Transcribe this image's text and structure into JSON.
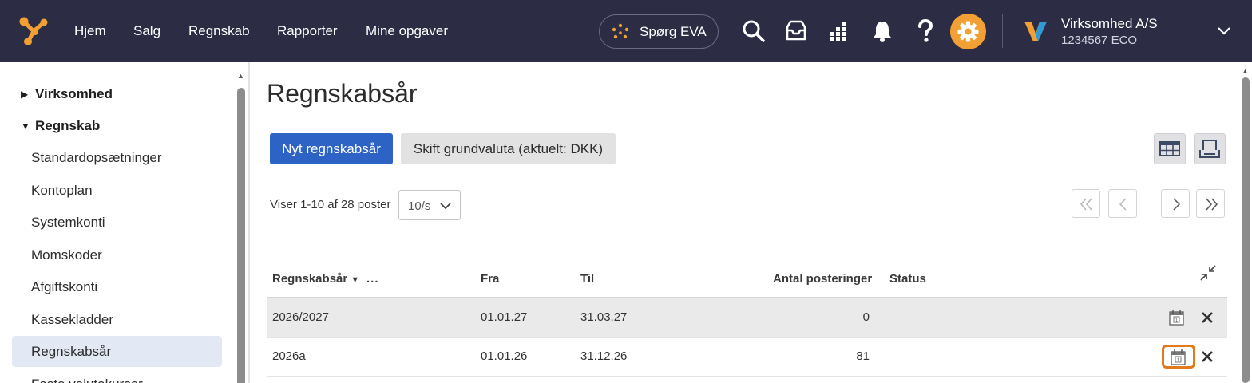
{
  "topbar": {
    "nav": [
      "Hjem",
      "Salg",
      "Regnskab",
      "Rapporter",
      "Mine opgaver"
    ],
    "eva_label": "Spørg EVA",
    "icons": [
      "search-icon",
      "inbox-icon",
      "apps-grid-icon",
      "bell-icon",
      "help-icon",
      "gear-icon"
    ],
    "company": {
      "name": "Virksomhed A/S",
      "id": "1234567 ECO"
    },
    "colors": {
      "background": "#2c2c45",
      "accent": "#f2a033"
    }
  },
  "sidebar": {
    "groups": [
      {
        "label": "Virksomhed",
        "expanded": false
      },
      {
        "label": "Regnskab",
        "expanded": true
      }
    ],
    "items": [
      "Standardopsætninger",
      "Kontoplan",
      "Systemkonti",
      "Momskoder",
      "Afgiftskonti",
      "Kassekladder",
      "Regnskabsår",
      "Faste valutakurser"
    ],
    "active_item": "Regnskabsår"
  },
  "main": {
    "title": "Regnskabsår",
    "primary_button": "Nyt regnskabsår",
    "secondary_button": "Skift grundvaluta (aktuelt: DKK)",
    "paging_info": "Viser 1-10 af 28 poster",
    "page_size": "10/s",
    "table": {
      "columns": [
        "Regnskabsår",
        "Fra",
        "Til",
        "Antal posteringer",
        "Status"
      ],
      "more_label": "...",
      "rows": [
        {
          "year": "2026/2027",
          "from": "01.01.27",
          "to": "31.03.27",
          "postings": "0",
          "status": ""
        },
        {
          "year": "2026a",
          "from": "01.01.26",
          "to": "31.12.26",
          "postings": "81",
          "status": ""
        }
      ]
    },
    "colors": {
      "primary": "#2d63c4",
      "focus": "#e2791c"
    }
  }
}
